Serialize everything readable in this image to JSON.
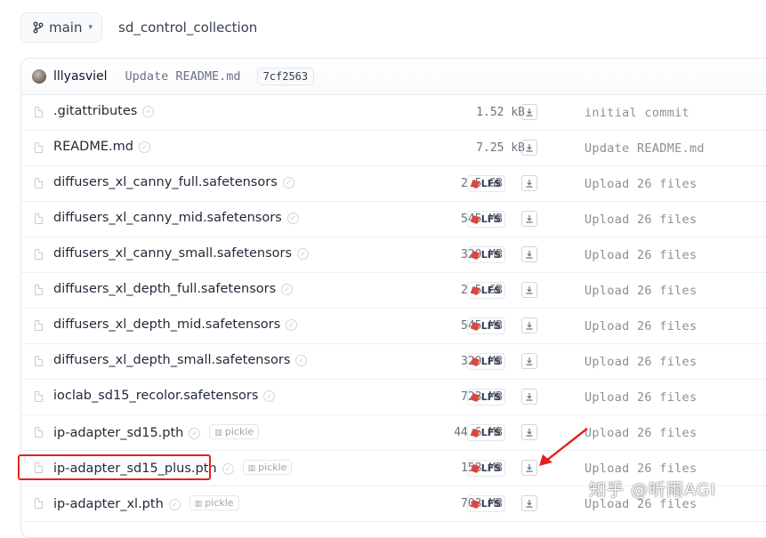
{
  "branch": {
    "icon": "git-branch-icon",
    "label": "main",
    "caret": "▾"
  },
  "repo_name": "sd_control_collection",
  "last_commit": {
    "author": "lllyasviel",
    "message": "Update README.md",
    "sha": "7cf2563"
  },
  "files": [
    {
      "name": ".gitattributes",
      "size": "1.52 kB",
      "lfs": false,
      "pickle": false,
      "commit": "initial commit"
    },
    {
      "name": "README.md",
      "size": "7.25 kB",
      "lfs": false,
      "pickle": false,
      "commit": "Update README.md"
    },
    {
      "name": "diffusers_xl_canny_full.safetensors",
      "size": "2.5 GB",
      "lfs": true,
      "pickle": false,
      "commit": "Upload 26 files"
    },
    {
      "name": "diffusers_xl_canny_mid.safetensors",
      "size": "545 MB",
      "lfs": true,
      "pickle": false,
      "commit": "Upload 26 files"
    },
    {
      "name": "diffusers_xl_canny_small.safetensors",
      "size": "320 MB",
      "lfs": true,
      "pickle": false,
      "commit": "Upload 26 files"
    },
    {
      "name": "diffusers_xl_depth_full.safetensors",
      "size": "2.5 GB",
      "lfs": true,
      "pickle": false,
      "commit": "Upload 26 files"
    },
    {
      "name": "diffusers_xl_depth_mid.safetensors",
      "size": "545 MB",
      "lfs": true,
      "pickle": false,
      "commit": "Upload 26 files"
    },
    {
      "name": "diffusers_xl_depth_small.safetensors",
      "size": "320 MB",
      "lfs": true,
      "pickle": false,
      "commit": "Upload 26 files"
    },
    {
      "name": "ioclab_sd15_recolor.safetensors",
      "size": "723 MB",
      "lfs": true,
      "pickle": false,
      "commit": "Upload 26 files"
    },
    {
      "name": "ip-adapter_sd15.pth",
      "size": "44.6 MB",
      "lfs": true,
      "pickle": true,
      "commit": "Upload 26 files"
    },
    {
      "name": "ip-adapter_sd15_plus.pth",
      "size": "158 MB",
      "lfs": true,
      "pickle": true,
      "commit": "Upload 26 files"
    },
    {
      "name": "ip-adapter_xl.pth",
      "size": "703 MB",
      "lfs": true,
      "pickle": true,
      "commit": "Upload 26 files"
    }
  ],
  "labels": {
    "lfs": "LFS",
    "pickle": "pickle",
    "download_icon": "download-icon"
  },
  "annotation": {
    "highlight_color": "#e0231f",
    "arrow_color": "#e0231f"
  },
  "watermark": "知乎 @听雨AGI"
}
